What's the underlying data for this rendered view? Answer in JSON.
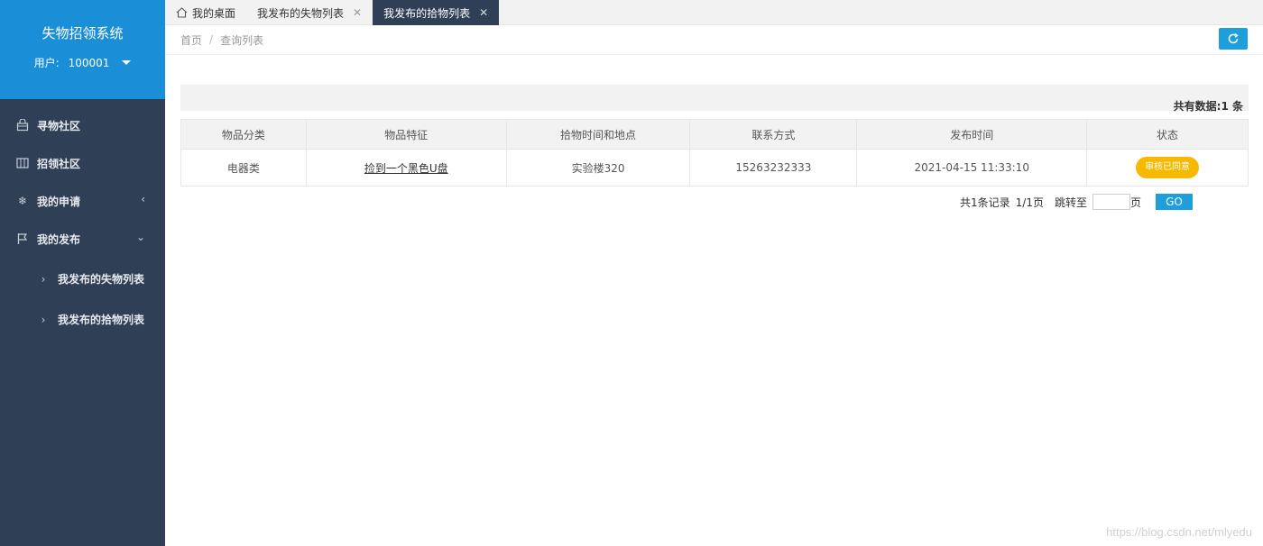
{
  "app": {
    "title": "失物招领系统",
    "user_label": "用户:",
    "user_id": "100001"
  },
  "sidebar": {
    "items": [
      {
        "label": "寻物社区",
        "icon": "bag-icon"
      },
      {
        "label": "招领社区",
        "icon": "columns-icon"
      },
      {
        "label": "我的申请",
        "icon": "snowflake-icon",
        "arrow": "‹"
      },
      {
        "label": "我的发布",
        "icon": "flag-icon",
        "arrow": "⌄"
      }
    ],
    "subitems": [
      {
        "label": "我发布的失物列表"
      },
      {
        "label": "我发布的拾物列表"
      }
    ]
  },
  "tabs": [
    {
      "label": "我的桌面",
      "home": true
    },
    {
      "label": "我发布的失物列表",
      "closable": true
    },
    {
      "label": "我发布的拾物列表",
      "closable": true,
      "active": true
    }
  ],
  "breadcrumb": {
    "home": "首页",
    "sep": "/",
    "current": "查询列表"
  },
  "summary": {
    "count_text": "共有数据:1 条"
  },
  "table": {
    "headers": [
      "物品分类",
      "物品特征",
      "拾物时间和地点",
      "联系方式",
      "发布时间",
      "状态"
    ],
    "rows": [
      {
        "category": "电器类",
        "feature": "捡到一个黑色U盘",
        "place": "实验楼320",
        "contact": "15263232333",
        "time": "2021-04-15 11:33:10",
        "status": "审核已同意"
      }
    ]
  },
  "pager": {
    "records": "共1条记录",
    "pages": "1/1页",
    "jump_label": "跳转至",
    "page_unit": "页",
    "go_label": "GO"
  },
  "watermark": "https://blog.csdn.net/mlyedu",
  "colors": {
    "sidebar": "#2f4056",
    "brand": "#1a8fd7",
    "accent": "#1e9fdb",
    "badge": "#f6b800"
  }
}
